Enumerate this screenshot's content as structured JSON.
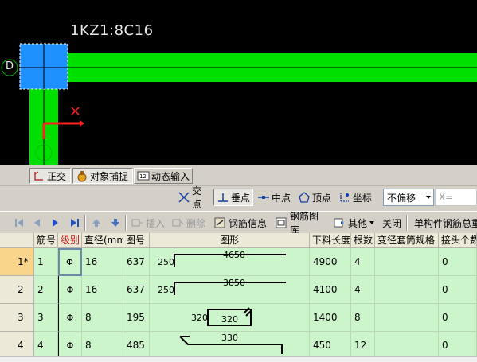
{
  "cad": {
    "element_label": "1KZ1:8C16",
    "axis_label": "D",
    "colors": {
      "background": "#000000",
      "beam": "#00e000",
      "column": "#1e90ff",
      "red_axis": "#ff2020"
    }
  },
  "snapbar": {
    "items": [
      {
        "label": "正交",
        "icon": "ortho-icon"
      },
      {
        "label": "对象捕捉",
        "icon": "object-snap-icon"
      },
      {
        "label": "动态输入",
        "icon": "dynamic-input-icon"
      }
    ]
  },
  "modebar": {
    "items": [
      {
        "label": "交点",
        "icon": "intersection-icon"
      },
      {
        "label": "垂点",
        "icon": "perpendicular-icon"
      },
      {
        "label": "中点",
        "icon": "midpoint-icon"
      },
      {
        "label": "顶点",
        "icon": "vertex-icon"
      },
      {
        "label": "坐标",
        "icon": "coordinate-icon"
      }
    ],
    "offset_select": "不偏移",
    "x_field_label": "X="
  },
  "gridbar": {
    "insert": "插入",
    "delete": "删除",
    "rebar_info": "钢筋信息",
    "rebar_library": "钢筋图库",
    "other": "其他",
    "close": "关闭",
    "summary": "单构件钢筋总重"
  },
  "table": {
    "headers": [
      "筋号",
      "级别",
      "直径(mm)",
      "图号",
      "图形",
      "下料长度",
      "根数",
      "变径套筒规格",
      "接头个数"
    ],
    "rows": [
      {
        "row_num": "1*",
        "bar_no": "1",
        "grade": "Φ",
        "diameter": "16",
        "shape_no": "637",
        "shape_left": "250",
        "shape_top": "4650",
        "shape_mid": "",
        "cut_length": "4900",
        "count": "4",
        "sleeve": "",
        "joints": "0"
      },
      {
        "row_num": "2",
        "bar_no": "2",
        "grade": "Φ",
        "diameter": "16",
        "shape_no": "637",
        "shape_left": "250",
        "shape_top": "3850",
        "shape_mid": "",
        "cut_length": "4100",
        "count": "4",
        "sleeve": "",
        "joints": "0"
      },
      {
        "row_num": "3",
        "bar_no": "3",
        "grade": "Φ",
        "diameter": "8",
        "shape_no": "195",
        "shape_left": "320",
        "shape_top": "",
        "shape_mid": "320",
        "cut_length": "1400",
        "count": "8",
        "sleeve": "",
        "joints": "0"
      },
      {
        "row_num": "4",
        "bar_no": "4",
        "grade": "Φ",
        "diameter": "8",
        "shape_no": "485",
        "shape_left": "",
        "shape_top": "330",
        "shape_mid": "",
        "cut_length": "450",
        "count": "12",
        "sleeve": "",
        "joints": "0"
      }
    ]
  }
}
